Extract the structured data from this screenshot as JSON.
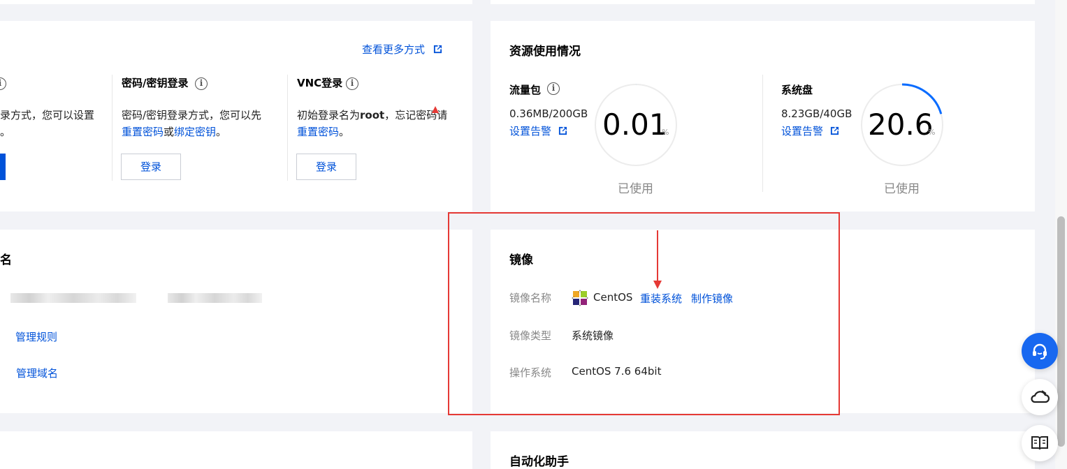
{
  "login": {
    "more_link": "查看更多方式",
    "partial_text_1": "录方式，您可以设置",
    "partial_text_2": "。",
    "password": {
      "title": "密码/密钥登录",
      "desc_1": "密码/密钥登录方式，您可以先",
      "reset_link": "重置密码",
      "or": "或",
      "bind_link": "绑定密钥",
      "period": "。",
      "button": "登录"
    },
    "vnc": {
      "title": "VNC登录",
      "desc_prefix": "初始登录名为",
      "root": "root",
      "desc_suffix": "，忘记密码请",
      "reset_link": "重置密码",
      "period": "。",
      "button": "登录"
    }
  },
  "resources": {
    "title": "资源使用情况",
    "traffic": {
      "label": "流量包",
      "value": "0.36MB/200GB",
      "alert_link": "设置告警",
      "percent": "0.01",
      "unit": "%",
      "used_label": "已使用",
      "fraction": 0.0001
    },
    "disk": {
      "label": "系统盘",
      "value": "8.23GB/40GB",
      "alert_link": "设置告警",
      "percent": "20.6",
      "unit": "%",
      "used_label": "已使用",
      "fraction": 0.206
    }
  },
  "domain": {
    "title_partial": "名",
    "manage_rules": "管理规则",
    "manage_domains": "管理域名"
  },
  "image": {
    "title": "镜像",
    "name_label": "镜像名称",
    "name_value": "CentOS",
    "reinstall_link": "重装系统",
    "make_image_link": "制作镜像",
    "type_label": "镜像类型",
    "type_value": "系统镜像",
    "os_label": "操作系统",
    "os_value": "CentOS 7.6 64bit"
  },
  "automation": {
    "title": "自动化助手"
  },
  "colors": {
    "accent": "#0052d9",
    "annotation": "#e53935",
    "progress": "#0a6cff"
  },
  "float_buttons": [
    "headset-icon",
    "cloud-icon",
    "book-icon"
  ]
}
